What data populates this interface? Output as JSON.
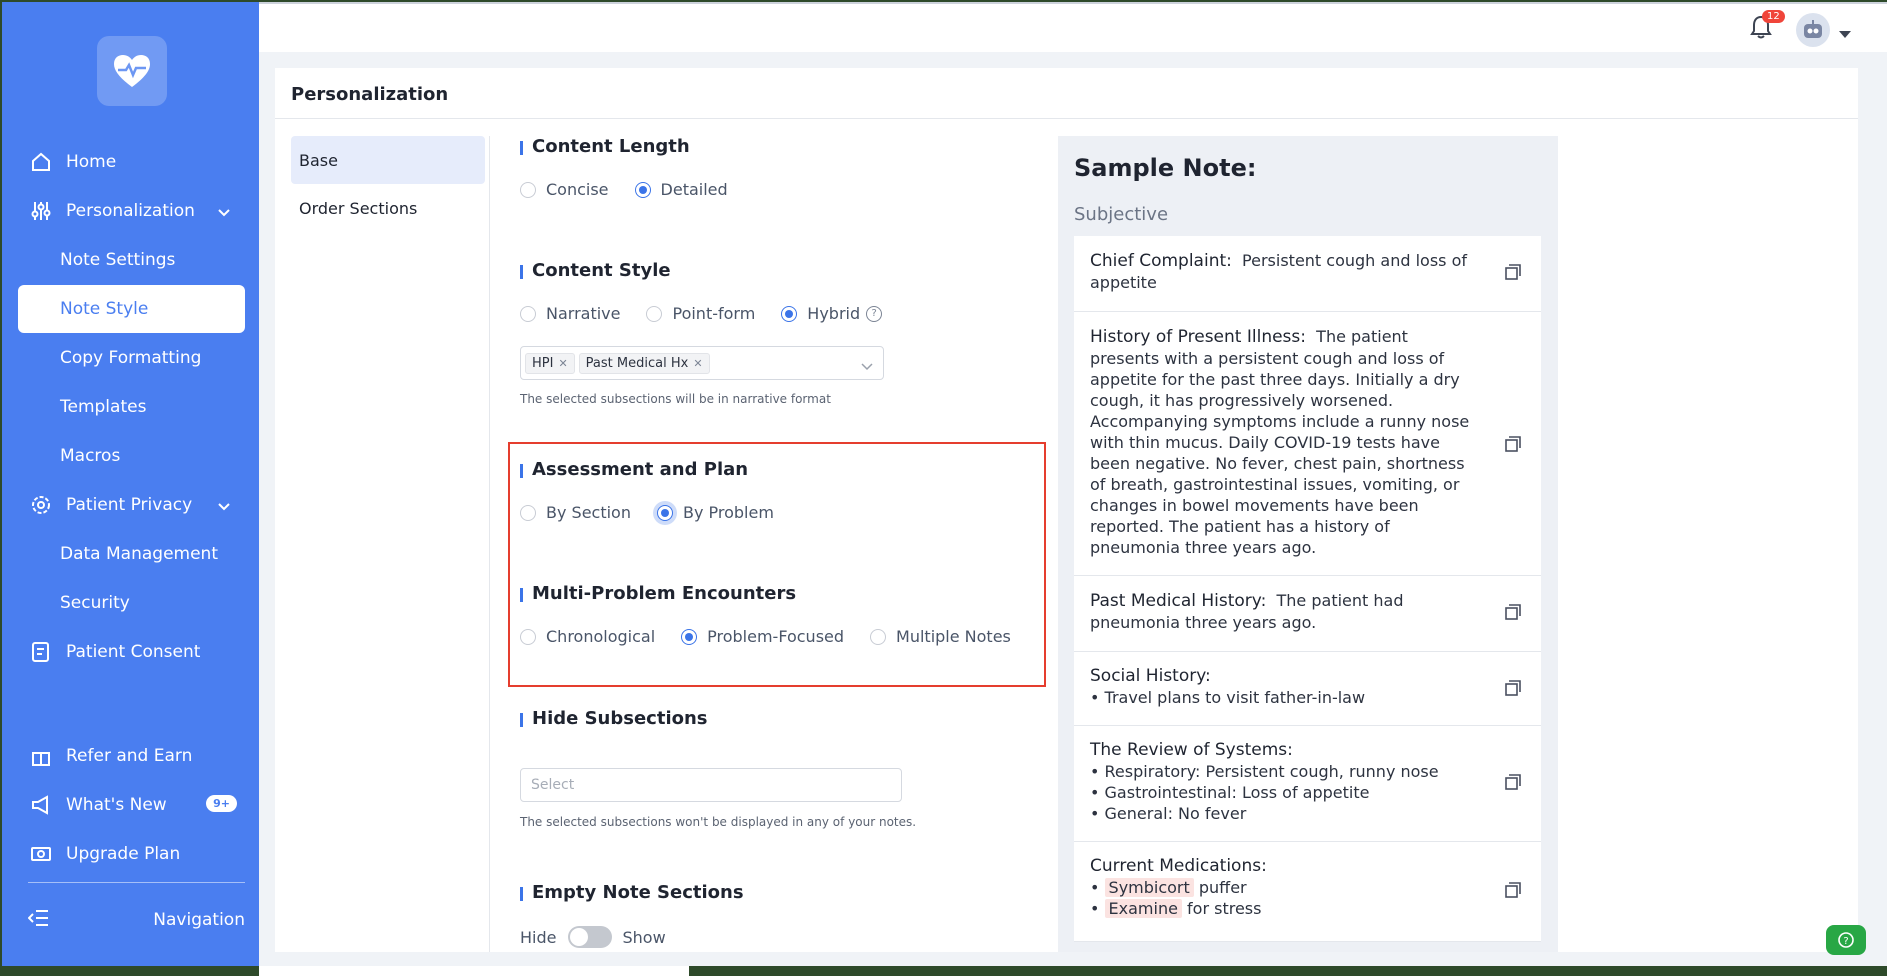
{
  "sidebar": {
    "items": [
      {
        "label": "Home"
      },
      {
        "label": "Personalization"
      },
      {
        "label": "Note Settings"
      },
      {
        "label": "Note Style"
      },
      {
        "label": "Copy Formatting"
      },
      {
        "label": "Templates"
      },
      {
        "label": "Macros"
      },
      {
        "label": "Patient Privacy"
      },
      {
        "label": "Data Management"
      },
      {
        "label": "Security"
      },
      {
        "label": "Patient Consent"
      }
    ],
    "footer": [
      {
        "label": "Refer and Earn"
      },
      {
        "label": "What's New",
        "badge": "9+"
      },
      {
        "label": "Upgrade Plan"
      }
    ],
    "collapse_label": "Navigation"
  },
  "topbar": {
    "notification_count": "12"
  },
  "page": {
    "title": "Personalization"
  },
  "subnav": {
    "items": [
      "Base",
      "Order Sections"
    ]
  },
  "settings": {
    "content_length": {
      "title": "Content Length",
      "options": [
        "Concise",
        "Detailed"
      ],
      "selected": "Detailed"
    },
    "content_style": {
      "title": "Content Style",
      "options": [
        "Narrative",
        "Point-form",
        "Hybrid"
      ],
      "selected": "Hybrid",
      "tags": [
        "HPI",
        "Past Medical Hx"
      ],
      "hint": "The selected subsections will be in narrative format"
    },
    "assessment_plan": {
      "title": "Assessment and Plan",
      "options": [
        "By Section",
        "By Problem"
      ],
      "selected": "By Problem"
    },
    "multi_problem": {
      "title": "Multi-Problem Encounters",
      "options": [
        "Chronological",
        "Problem-Focused",
        "Multiple Notes"
      ],
      "selected": "Problem-Focused"
    },
    "hide_subsections": {
      "title": "Hide Subsections",
      "placeholder": "Select",
      "hint": "The selected subsections won't be displayed in any of your notes."
    },
    "empty_sections": {
      "title": "Empty Note Sections",
      "off_label": "Hide",
      "on_label": "Show"
    }
  },
  "sample_note": {
    "title": "Sample Note:",
    "section": "Subjective",
    "items": [
      {
        "label": "Chief Complaint:",
        "text": "Persistent cough and loss of appetite"
      },
      {
        "label": "History of Present Illness:",
        "text": "The patient presents with a persistent cough and loss of appetite for the past three days. Initially a dry cough, it has progressively worsened. Accompanying symptoms include a runny nose with thin mucus. Daily COVID-19 tests have been negative. No fever, chest pain, shortness of breath, gastrointestinal issues, vomiting, or changes in bowel movements have been reported. The patient has a history of pneumonia three years ago."
      },
      {
        "label": "Past Medical History:",
        "text": "The patient had pneumonia three years ago."
      },
      {
        "label": "Social History:",
        "bullets": [
          "• Travel plans to visit father-in-law"
        ]
      },
      {
        "label": "The Review of Systems:",
        "bullets": [
          "• Respiratory: Persistent cough, runny nose",
          "• Gastrointestinal: Loss of appetite",
          "• General: No fever"
        ]
      },
      {
        "label": "Current Medications:",
        "meds": [
          {
            "name": "Symbicort",
            "note": "puffer"
          },
          {
            "name": "Examine",
            "note": "for stress"
          }
        ]
      }
    ]
  },
  "colors": {
    "sidebar": "#4a7ef0",
    "accent": "#3b74e8",
    "highlight_border": "#e53d2e",
    "badge_red": "#f0453a"
  }
}
